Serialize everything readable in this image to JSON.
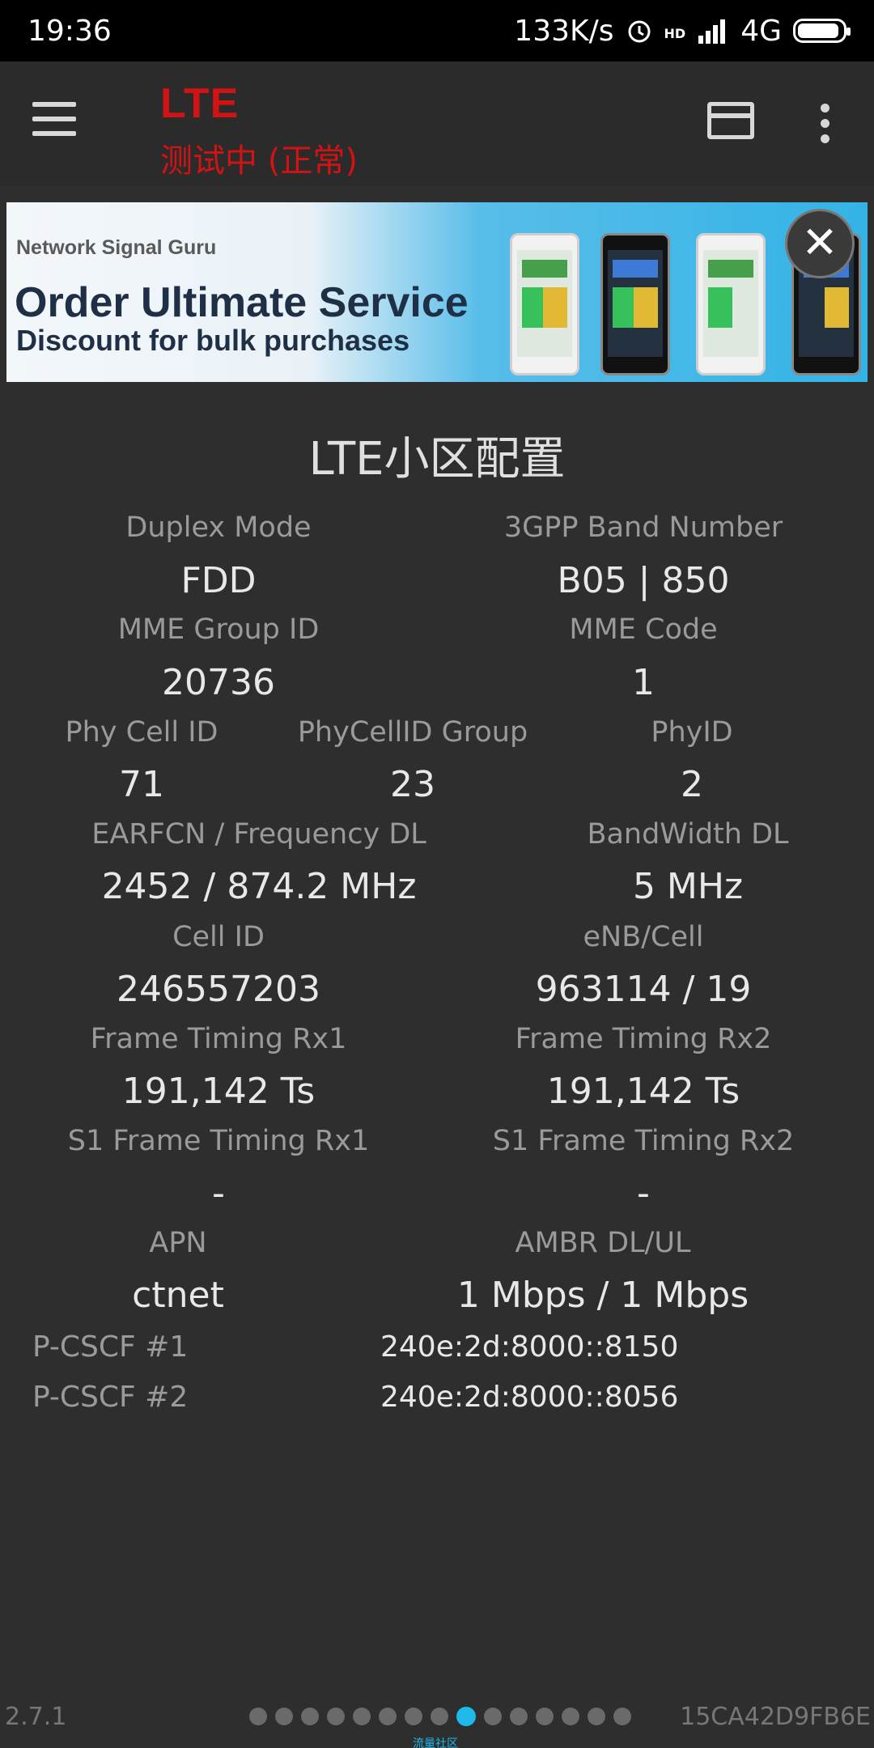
{
  "status_bar": {
    "time": "19:36",
    "net_speed": "133K/s",
    "hd": "HD",
    "network": "4G",
    "icons": [
      "alarm-icon",
      "signal-icon",
      "battery-icon"
    ]
  },
  "toolbar": {
    "title": "LTE",
    "subtitle": "测试中 (正常)",
    "title_color": "#d21313",
    "icons": [
      "hamburger-menu-icon",
      "card-icon",
      "more-vert-icon"
    ]
  },
  "ad": {
    "small": "Network Signal Guru",
    "headline": "Order Ultimate Service",
    "tagline": "Discount for bulk purchases",
    "close_label": "✕"
  },
  "section_title": "LTE小区配置",
  "fields": {
    "duplex_mode": {
      "label": "Duplex Mode",
      "value": "FDD"
    },
    "band_number": {
      "label": "3GPP Band Number",
      "value": "B05 | 850"
    },
    "mme_group_id": {
      "label": "MME Group ID",
      "value": "20736"
    },
    "mme_code": {
      "label": "MME Code",
      "value": "1"
    },
    "phy_cell_id": {
      "label": "Phy Cell ID",
      "value": "71"
    },
    "phycellid_group": {
      "label": "PhyCellID Group",
      "value": "23"
    },
    "phy_id": {
      "label": "PhyID",
      "value": "2"
    },
    "earfcn": {
      "label": "EARFCN / Frequency DL",
      "value": "2452 / 874.2 MHz"
    },
    "bandwidth": {
      "label": "BandWidth DL",
      "value": "5 MHz"
    },
    "cell_id": {
      "label": "Cell ID",
      "value": "246557203"
    },
    "enb_cell": {
      "label": "eNB/Cell",
      "value": "963114 / 19"
    },
    "frame_rx1": {
      "label": "Frame Timing Rx1",
      "value": "191,142 Ts"
    },
    "frame_rx2": {
      "label": "Frame Timing Rx2",
      "value": "191,142 Ts"
    },
    "s1_frame_rx1": {
      "label": "S1 Frame Timing Rx1",
      "value": "-"
    },
    "s1_frame_rx2": {
      "label": "S1 Frame Timing Rx2",
      "value": "-"
    },
    "apn": {
      "label": "APN",
      "value": "ctnet"
    },
    "ambr": {
      "label": "AMBR DL/UL",
      "value": "1 Mbps / 1 Mbps"
    }
  },
  "pcscf": [
    {
      "label": "P-CSCF #1",
      "value": "240e:2d:8000::8150"
    },
    {
      "label": "P-CSCF #2",
      "value": "240e:2d:8000::8056"
    }
  ],
  "footer": {
    "version": "2.7.1",
    "device_id": "15CA42D9FB6E",
    "watermark": "流量社区",
    "page_count": 15,
    "active_page": 9,
    "active_color": "#1fb8e8"
  }
}
